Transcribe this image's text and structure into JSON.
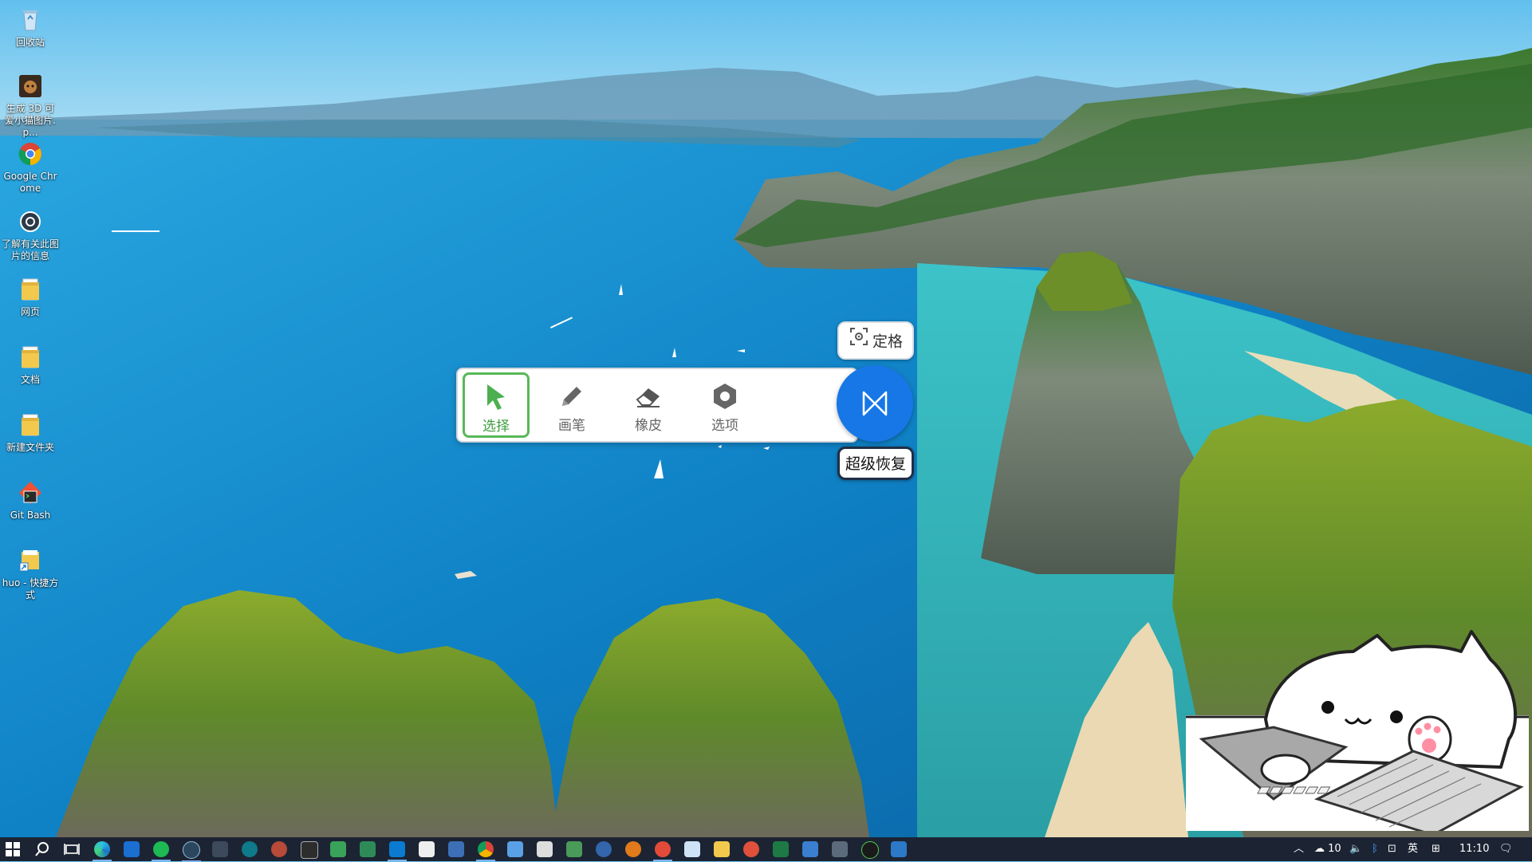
{
  "desktop": {
    "icons": [
      {
        "label": "回收站",
        "icon": "recycle-bin-icon"
      },
      {
        "label": "生成 3D 可爱小猫图片.p...",
        "icon": "image-file-icon"
      },
      {
        "label": "Google Chrome",
        "icon": "chrome-icon"
      },
      {
        "label": "了解有关此图片的信息",
        "icon": "info-camera-icon"
      },
      {
        "label": "网页",
        "icon": "folder-icon"
      },
      {
        "label": "文档",
        "icon": "folder-icon"
      },
      {
        "label": "新建文件夹",
        "icon": "folder-icon"
      },
      {
        "label": "Git Bash",
        "icon": "git-bash-icon"
      },
      {
        "label": "huo - 快捷方式",
        "icon": "shortcut-icon"
      }
    ]
  },
  "toolbar": {
    "tools": [
      {
        "label": "选择",
        "icon": "cursor-arrow-icon",
        "active": true
      },
      {
        "label": "画笔",
        "icon": "pencil-icon",
        "active": false
      },
      {
        "label": "橡皮",
        "icon": "eraser-icon",
        "active": false
      },
      {
        "label": "选项",
        "icon": "hexagon-settings-icon",
        "active": false
      }
    ],
    "freeze_label": "定格",
    "restore_label": "超级恢复",
    "active_color": "#58b858",
    "restore_color": "#1877e6"
  },
  "taskbar": {
    "apps": [
      "start-icon",
      "search-icon",
      "task-view-icon",
      "edge-icon",
      "outlook-icon",
      "spotify-icon",
      "steam-icon",
      "app-icon",
      "app-icon",
      "app-icon",
      "terminal-icon",
      "app-icon",
      "app-icon",
      "vscode-icon",
      "app-icon",
      "app-icon",
      "chrome-icon",
      "app-icon",
      "app-icon",
      "app-icon",
      "app-icon",
      "search-app-icon",
      "app-icon",
      "app-icon",
      "file-explorer-icon",
      "app-icon",
      "excel-icon",
      "app-icon",
      "app-icon",
      "app-icon",
      "app-icon"
    ],
    "tray": {
      "temperature": "10",
      "ime": "英",
      "time": "11:10"
    }
  }
}
